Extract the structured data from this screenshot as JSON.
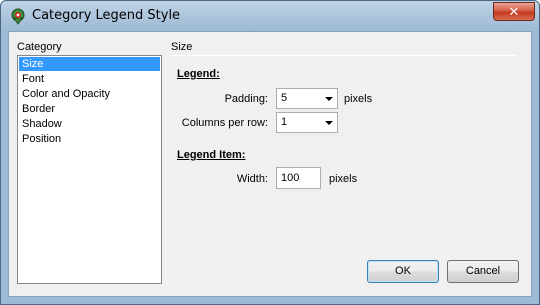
{
  "window": {
    "title": "Category Legend Style",
    "close_label": "✕"
  },
  "category": {
    "label": "Category",
    "items": [
      "Size",
      "Font",
      "Color and Opacity",
      "Border",
      "Shadow",
      "Position"
    ],
    "selected": "Size"
  },
  "section": {
    "title": "Size"
  },
  "legend": {
    "heading": "Legend:",
    "padding_label": "Padding:",
    "padding_value": "5",
    "padding_unit": "pixels",
    "columns_label": "Columns per row:",
    "columns_value": "1"
  },
  "legend_item": {
    "heading": "Legend Item:",
    "width_label": "Width:",
    "width_value": "100",
    "width_unit": "pixels"
  },
  "buttons": {
    "ok": "OK",
    "cancel": "Cancel"
  },
  "colors": {
    "selection": "#3399ff",
    "titlebar": "#9db9d3",
    "close": "#c4391f"
  },
  "icons": {
    "app": "map-pin-icon",
    "close": "close-icon",
    "dropdown": "chevron-down-icon"
  }
}
